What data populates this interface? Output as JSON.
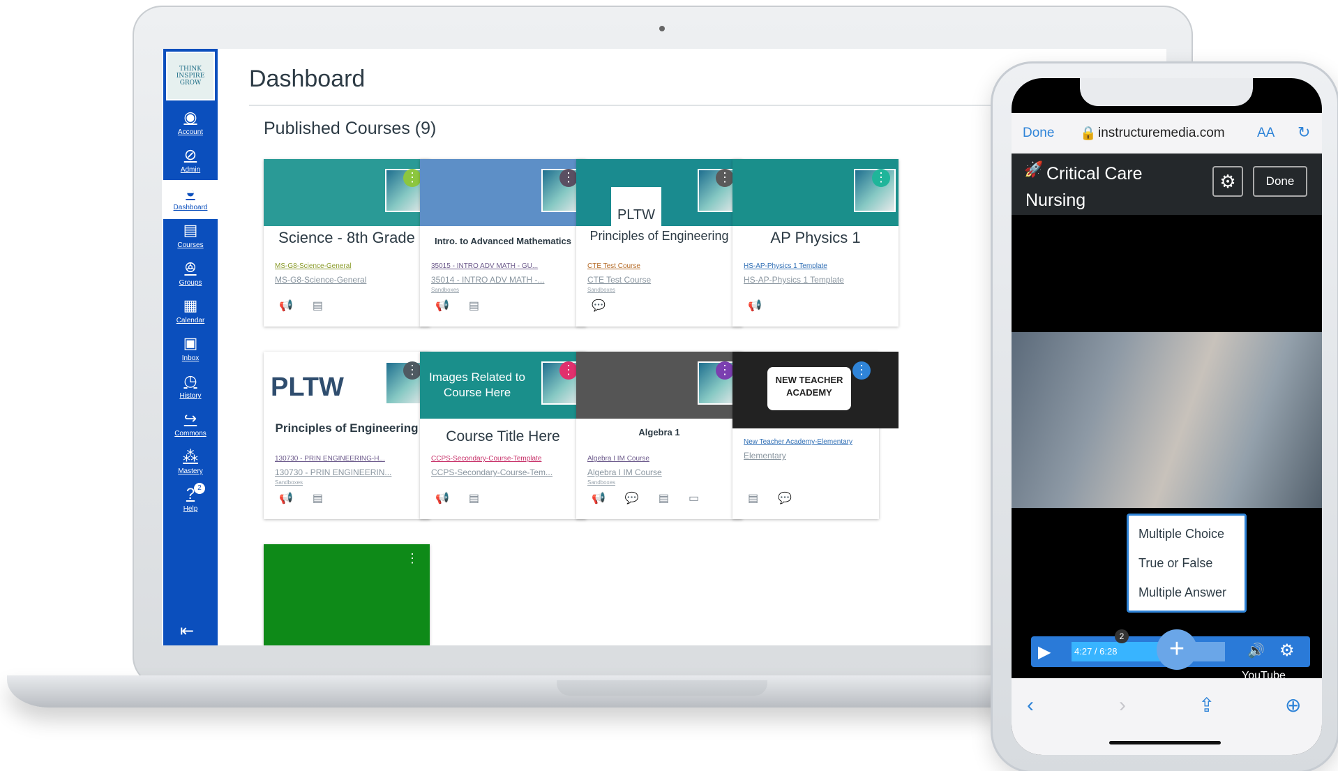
{
  "laptop": {
    "logo_text": "THINK INSPIRE GROW",
    "nav": [
      {
        "label": "Account",
        "icon": "account-icon"
      },
      {
        "label": "Admin",
        "icon": "admin-icon"
      },
      {
        "label": "Dashboard",
        "icon": "dashboard-icon"
      },
      {
        "label": "Courses",
        "icon": "courses-icon"
      },
      {
        "label": "Groups",
        "icon": "groups-icon"
      },
      {
        "label": "Calendar",
        "icon": "calendar-icon"
      },
      {
        "label": "Inbox",
        "icon": "inbox-icon"
      },
      {
        "label": "History",
        "icon": "history-icon"
      },
      {
        "label": "Commons",
        "icon": "commons-icon"
      },
      {
        "label": "Mastery",
        "icon": "mastery-icon"
      },
      {
        "label": "Help",
        "icon": "help-icon",
        "badge": "2"
      }
    ],
    "dashboard": {
      "title": "Dashboard",
      "section": "Published Courses (9)",
      "cards": [
        {
          "title": "Science - 8th Grade",
          "link1": "MS-G8-Science-General",
          "link2": "MS-G8-Science-General",
          "link3": "",
          "color": "#2a9a96"
        },
        {
          "title": "Intro. to Advanced Mathematics",
          "link1": "35015 - INTRO ADV MATH - GU...",
          "link2": "35014 - INTRO ADV MATH -...",
          "link3": "Sandboxes",
          "color": "#5d8fc7"
        },
        {
          "title": "Principles of Engineering",
          "link1": "CTE Test Course",
          "link2": "CTE Test Course",
          "link3": "Sandboxes",
          "color": "#1a8b8f",
          "hero_text": "PLTW"
        },
        {
          "title": "AP Physics 1",
          "link1": "HS-AP-Physics 1 Template",
          "link2": "HS-AP-Physics 1 Template",
          "link3": "",
          "color": "#1a8f8b"
        },
        {
          "title": "Principles of Engineering",
          "link1": "130730 - PRIN ENGINEERING-H...",
          "link2": "130730 - PRIN ENGINEERIN...",
          "link3": "Sandboxes",
          "color": "#ffffff",
          "hero_text": "PLTW"
        },
        {
          "title": "Course Title Here",
          "link1": "CCPS-Secondary-Course-Template",
          "link2": "CCPS-Secondary-Course-Tem...",
          "link3": "",
          "color": "#1a8f8b",
          "hero_text": "Images Related to Course Here"
        },
        {
          "title": "Algebra 1",
          "link1": "Algebra I IM Course",
          "link2": "Algebra I IM Course",
          "link3": "Sandboxes",
          "color": "#555555"
        },
        {
          "title": "",
          "link1": "New Teacher Academy-Elementary",
          "link2": "Elementary",
          "link3": "",
          "color": "#222222",
          "hero_text": "NEW TEACHER ACADEMY"
        },
        {
          "title": "",
          "link1": "",
          "link2": "",
          "link3": "",
          "color": "#0e8a18"
        }
      ]
    }
  },
  "phone": {
    "safari": {
      "done": "Done",
      "url": "instructuremedia.com",
      "text_size": "AA"
    },
    "media": {
      "title": "Critical Care Nursing",
      "done": "Done"
    },
    "menu": [
      "Multiple Choice",
      "True or False",
      "Multiple Answer"
    ],
    "player": {
      "time": "4:27 / 6:28",
      "marker": "2",
      "progress": 0.69,
      "brand": "YouTube"
    }
  }
}
